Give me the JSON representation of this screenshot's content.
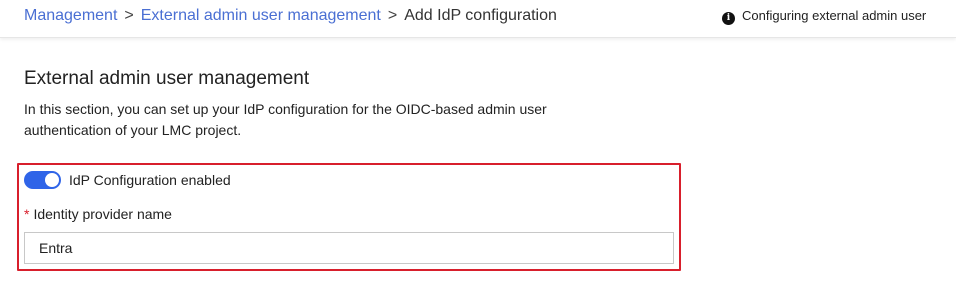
{
  "breadcrumb": {
    "items": [
      "Management",
      "External admin user management"
    ],
    "separator": ">",
    "current": "Add IdP configuration"
  },
  "notice": {
    "icon": "info-icon",
    "text": "Configuring external admin user"
  },
  "section": {
    "title": "External admin user management",
    "description": "In this section, you can set up your IdP configuration for the OIDC-based admin user authentication of your LMC project."
  },
  "idp_toggle": {
    "label": "IdP Configuration enabled",
    "enabled": true
  },
  "identity_provider": {
    "required_marker": "*",
    "label": "Identity provider name",
    "value": "Entra"
  },
  "colors": {
    "link": "#4a6fd3",
    "toggle_on": "#2f64e8",
    "highlight": "#d81f2c"
  }
}
